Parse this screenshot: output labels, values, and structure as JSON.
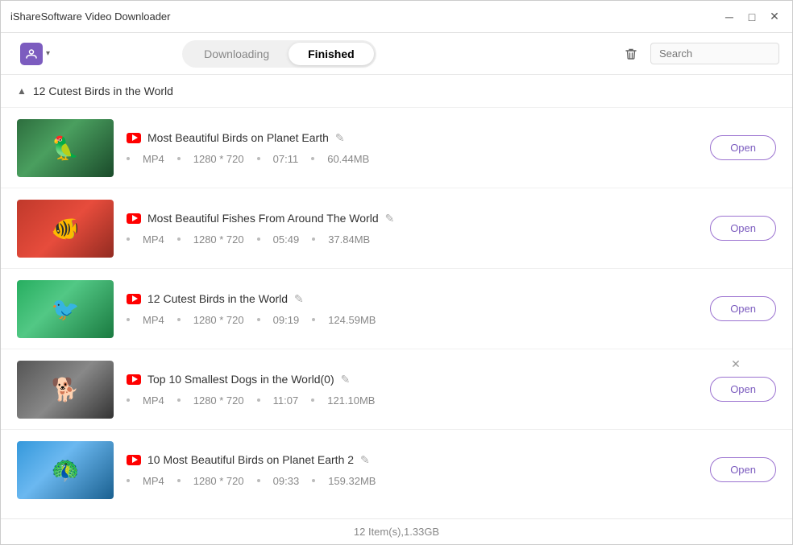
{
  "titlebar": {
    "title": "iShareSoftware Video Downloader",
    "controls": {
      "minimize": "─",
      "maximize": "□",
      "close": "✕"
    }
  },
  "toolbar": {
    "profile_icon": "↙",
    "tab_downloading": "Downloading",
    "tab_finished": "Finished",
    "active_tab": "finished",
    "search_placeholder": "Search",
    "delete_label": "delete"
  },
  "group": {
    "title": "12 Cutest Birds in the World",
    "collapsed": false
  },
  "videos": [
    {
      "id": 1,
      "title": "Most Beautiful Birds on Planet Earth",
      "format": "MP4",
      "resolution": "1280 * 720",
      "duration": "07:11",
      "size": "60.44MB",
      "thumb_class": "thumb-1",
      "has_close": false
    },
    {
      "id": 2,
      "title": "Most Beautiful Fishes From Around The World",
      "format": "MP4",
      "resolution": "1280 * 720",
      "duration": "05:49",
      "size": "37.84MB",
      "thumb_class": "thumb-2",
      "has_close": false
    },
    {
      "id": 3,
      "title": "12 Cutest Birds in the World",
      "format": "MP4",
      "resolution": "1280 * 720",
      "duration": "09:19",
      "size": "124.59MB",
      "thumb_class": "thumb-3",
      "has_close": false
    },
    {
      "id": 4,
      "title": "Top 10 Smallest Dogs in the World(0)",
      "format": "MP4",
      "resolution": "1280 * 720",
      "duration": "11:07",
      "size": "121.10MB",
      "thumb_class": "thumb-4",
      "has_close": true
    },
    {
      "id": 5,
      "title": "10 Most Beautiful Birds on Planet Earth 2",
      "format": "MP4",
      "resolution": "1280 * 720",
      "duration": "09:33",
      "size": "159.32MB",
      "thumb_class": "thumb-5",
      "has_close": false
    }
  ],
  "footer": {
    "summary": "12 Item(s),1.33GB"
  },
  "buttons": {
    "open": "Open"
  }
}
